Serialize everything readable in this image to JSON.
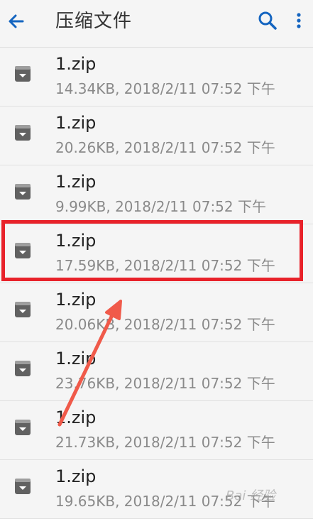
{
  "app_bar": {
    "title": "压缩文件",
    "back_icon": "arrow-back-icon",
    "search_icon": "search-icon",
    "more_icon": "more-vert-icon",
    "accent_color": "#1565c0"
  },
  "files": [
    {
      "name": "1.zip",
      "meta": "14.34KB, 2018/2/11 07:52 下午",
      "icon": "archive-icon"
    },
    {
      "name": "1.zip",
      "meta": "20.26KB, 2018/2/11 07:52 下午",
      "icon": "archive-icon"
    },
    {
      "name": "1.zip",
      "meta": "9.99KB, 2018/2/11 07:52 下午",
      "icon": "archive-icon"
    },
    {
      "name": "1.zip",
      "meta": "17.59KB, 2018/2/11 07:52 下午",
      "icon": "archive-icon"
    },
    {
      "name": "1.zip",
      "meta": "20.06KB, 2018/2/11 07:52 下午",
      "icon": "archive-icon"
    },
    {
      "name": "1.zip",
      "meta": "23.76KB, 2018/2/11 07:52 下午",
      "icon": "archive-icon"
    },
    {
      "name": "1.zip",
      "meta": "21.73KB, 2018/2/11 07:52 下午",
      "icon": "archive-icon"
    },
    {
      "name": "1.zip",
      "meta": "19.65KB, 2018/2/11 07:52 下午",
      "icon": "archive-icon"
    }
  ],
  "annotation": {
    "highlight_color": "#e8222a",
    "highlighted_index": 3
  },
  "watermark": {
    "text": "Bai 经验"
  }
}
